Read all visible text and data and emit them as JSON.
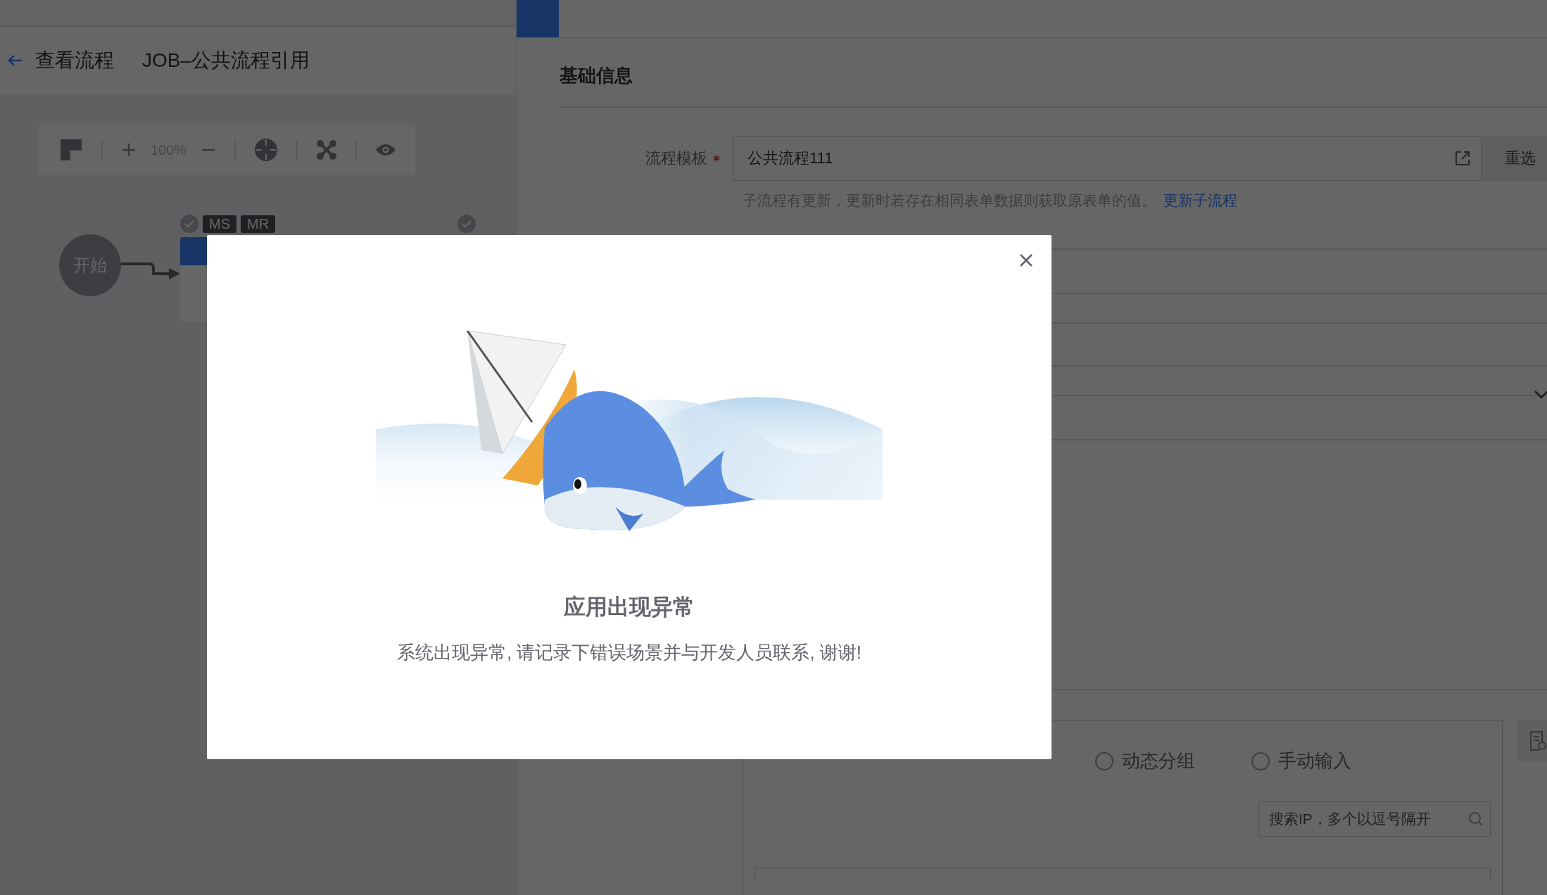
{
  "header": {
    "back_label": "查看流程",
    "flow_name": "JOB–公共流程引用"
  },
  "toolbar": {
    "zoom": "100%"
  },
  "canvas": {
    "start_node": "开始",
    "node_badges": [
      "MS",
      "MR"
    ]
  },
  "panel": {
    "section_title": "基础信息",
    "template_field": {
      "label": "流程模板",
      "required": true,
      "value": "公共流程111",
      "button": "重选",
      "hint": "子流程有更新，更新时若存在相同表单数据则获取原表单的值。",
      "hint_link": "更新子流程"
    },
    "target": {
      "options": [
        {
          "label": "动态分组",
          "selected": false
        },
        {
          "label": "手动输入",
          "selected": false
        }
      ],
      "search_placeholder": "搜索IP，多个以逗号隔开"
    }
  },
  "dialog": {
    "title": "应用出现异常",
    "message": "系统出现异常, 请记录下错误场景并与开发人员联系, 谢谢!"
  }
}
